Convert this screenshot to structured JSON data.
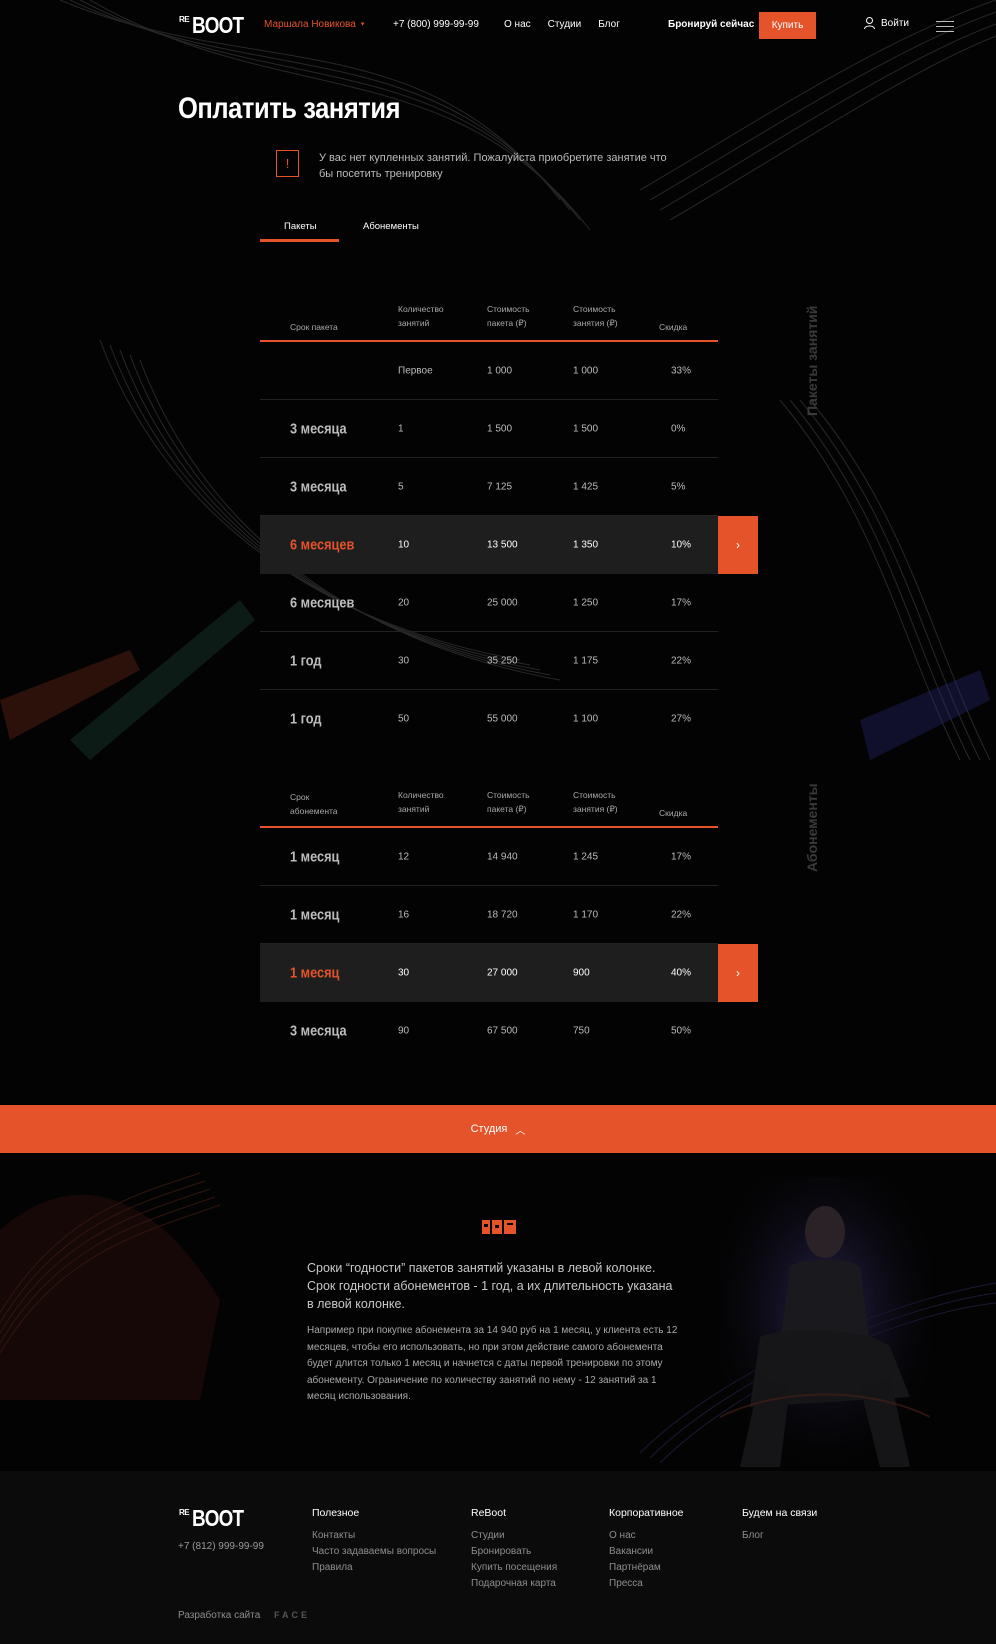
{
  "header": {
    "logo_top": "RE",
    "logo_main": "BOOT",
    "city": "Маршала Новикова",
    "phone": "+7 (800) 999-99-99",
    "nav": [
      "О нас",
      "Студии",
      "Блог"
    ],
    "book_now": "Бронируй сейчас",
    "buy": "Купить",
    "login": "Войти"
  },
  "page": {
    "title": "Оплатить занятия",
    "alert_icon": "!",
    "alert_text": "У вас нет купленных занятий. Пожалуйста приобретите занятие что бы посетить тренировку"
  },
  "tabs": [
    "Пакеты",
    "Абонементы"
  ],
  "packages": {
    "side_label": "Пакеты занятий",
    "headers": [
      "Срок пакета",
      "Количество занятий",
      "Стоимость пакета (₽)",
      "Стоимость занятия (₽)",
      "Скидка"
    ],
    "rows": [
      {
        "term": "",
        "count": "Первое",
        "price": "1 000",
        "unit": "1 000",
        "discount": "33%"
      },
      {
        "term": "3 месяца",
        "count": "1",
        "price": "1 500",
        "unit": "1 500",
        "discount": "0%"
      },
      {
        "term": "3 месяца",
        "count": "5",
        "price": "7 125",
        "unit": "1 425",
        "discount": "5%"
      },
      {
        "term": "6 месяцев",
        "count": "10",
        "price": "13 500",
        "unit": "1 350",
        "discount": "10%"
      },
      {
        "term": "6 месяцев",
        "count": "20",
        "price": "25 000",
        "unit": "1 250",
        "discount": "17%"
      },
      {
        "term": "1 год",
        "count": "30",
        "price": "35 250",
        "unit": "1 175",
        "discount": "22%"
      },
      {
        "term": "1 год",
        "count": "50",
        "price": "55 000",
        "unit": "1 100",
        "discount": "27%"
      }
    ]
  },
  "subscriptions": {
    "side_label": "Абонементы",
    "headers": [
      "Срок абонемента",
      "Количество занятий",
      "Стоимость пакета (₽)",
      "Стоимость занятия (₽)",
      "Скидка"
    ],
    "rows": [
      {
        "term": "1 месяц",
        "count": "12",
        "price": "14 940",
        "unit": "1 245",
        "discount": "17%"
      },
      {
        "term": "1 месяц",
        "count": "16",
        "price": "18 720",
        "unit": "1 170",
        "discount": "22%"
      },
      {
        "term": "1 месяц",
        "count": "30",
        "price": "27 000",
        "unit": "900",
        "discount": "40%"
      },
      {
        "term": "3 месяца",
        "count": "90",
        "price": "67 500",
        "unit": "750",
        "discount": "50%"
      }
    ]
  },
  "studio_bar": {
    "label": "Студия"
  },
  "info": {
    "lead": "Сроки “годности” пакетов занятий указаны в левой колонке. Срок годности абонементов - 1 год, а их длительность указана в левой колонке.",
    "body": "Например при покупке абонемента за 14 940 руб на 1 месяц, у клиента есть 12 месяцев, чтобы его использовать, но при этом действие самого абонемента будет длится только 1 месяц и начнется с даты первой тренировки по этому абонементу. Ограничение по количеству занятий по нему - 12 занятий за 1 месяц использования."
  },
  "footer": {
    "phone": "+7 (812) 999-99-99",
    "columns": [
      {
        "title": "Полезное",
        "links": [
          "Контакты",
          "Часто задаваемы вопросы",
          "Правила"
        ]
      },
      {
        "title": "ReBoot",
        "links": [
          "Студии",
          "Бронировать",
          "Купить посещения",
          "Подарочная карта"
        ]
      },
      {
        "title": "Корпоративное",
        "links": [
          "О нас",
          "Вакансии",
          "Партнёрам",
          "Пресса"
        ]
      },
      {
        "title": "Будем на связи",
        "links": [
          "Блог"
        ]
      }
    ],
    "dev_label": "Разработка сайта",
    "dev_brand": "FACE"
  },
  "colors": {
    "accent": "#e4532a",
    "background": "#030303",
    "row_highlight": "#1e1e1e"
  },
  "icons": [
    "user-icon",
    "menu-icon",
    "chevron-right-icon",
    "chevron-up-icon",
    "alert-icon"
  ]
}
